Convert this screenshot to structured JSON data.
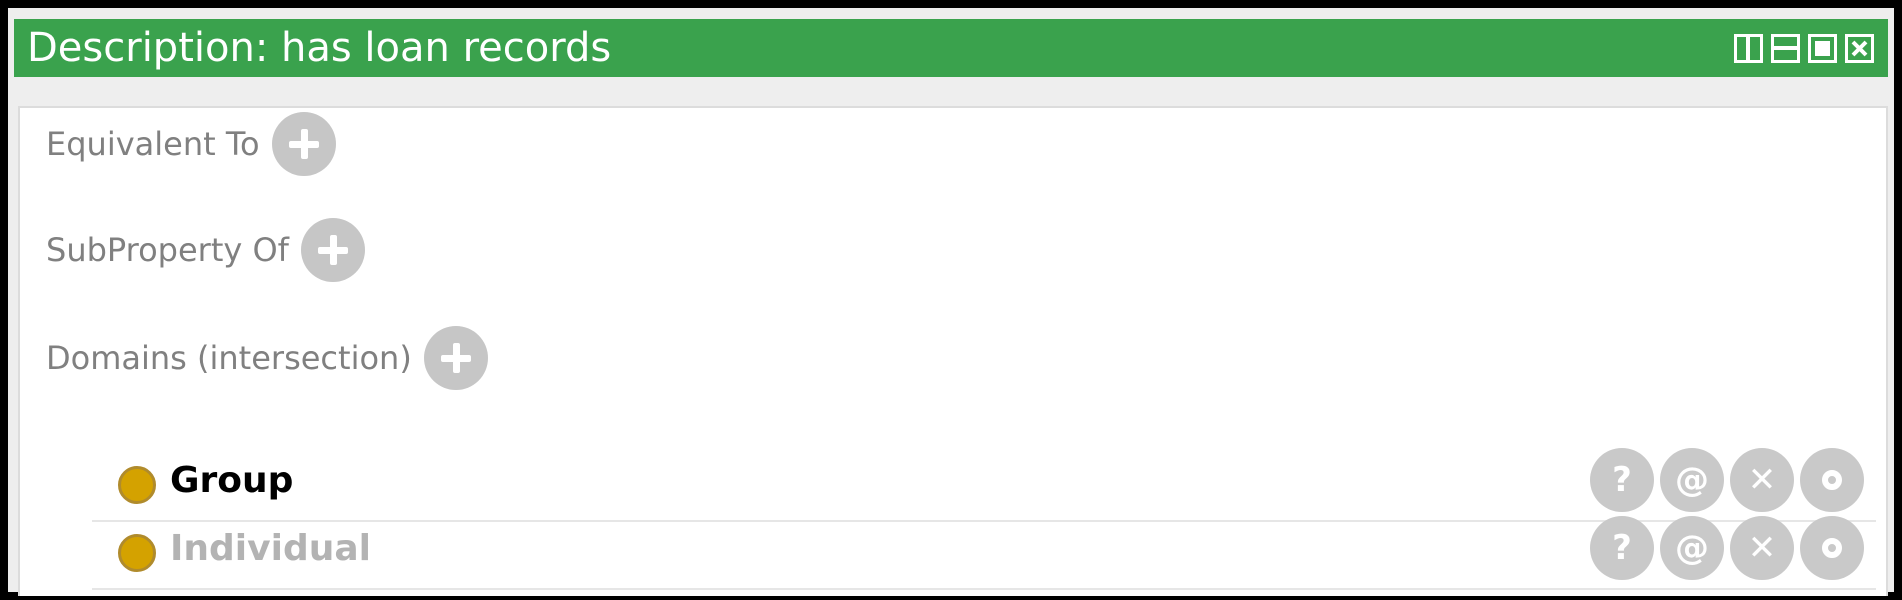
{
  "window": {
    "title": "Description: has loan records",
    "header_color": "#3aa24d",
    "controls": [
      "split-vertical-icon",
      "split-horizontal-icon",
      "maximize-icon",
      "close-icon"
    ]
  },
  "sections": {
    "equivalent_to": {
      "label": "Equivalent To"
    },
    "subproperty_of": {
      "label": "SubProperty Of"
    },
    "domains": {
      "label": "Domains (intersection)"
    }
  },
  "domains": [
    {
      "label": "Group",
      "style": "asserted",
      "icon": "class-icon",
      "icon_color": "#d4a200"
    },
    {
      "label": "Individual",
      "style": "inferred",
      "icon": "class-icon",
      "icon_color": "#d4a200"
    }
  ],
  "row_actions": {
    "explain": "?",
    "annotate": "@",
    "delete": "✕",
    "edit": "edit-ring-icon"
  }
}
